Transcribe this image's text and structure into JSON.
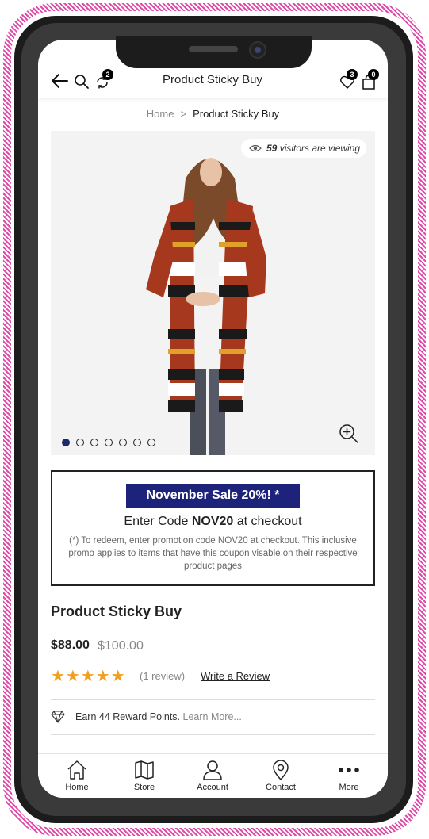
{
  "header": {
    "title": "Product Sticky Buy",
    "compare_count": "2",
    "wishlist_count": "3",
    "cart_count": "0"
  },
  "breadcrumb": {
    "home": "Home",
    "separator": ">",
    "current": "Product Sticky Buy"
  },
  "gallery": {
    "visitors_count": "59",
    "visitors_text": "visitors are viewing",
    "dots_total": 7,
    "active_dot": 1
  },
  "promo": {
    "title": "November Sale 20%! *",
    "code_prefix": "Enter Code ",
    "code": "NOV20",
    "code_suffix": " at checkout",
    "note": "(*) To redeem, enter promotion code NOV20 at checkout. This inclusive promo applies to items that have this coupon visable on their respective product pages"
  },
  "product": {
    "name": "Product Sticky Buy",
    "price": "$88.00",
    "old_price": "$100.00",
    "rating": 5,
    "stars": "★★★★★",
    "review_count": "(1 review)",
    "write_review": "Write a Review",
    "reward_text": "Earn 44 Reward Points.",
    "reward_link": "Learn More..."
  },
  "bottom_nav": [
    {
      "label": "Home",
      "icon": "home-icon"
    },
    {
      "label": "Store",
      "icon": "map-icon"
    },
    {
      "label": "Account",
      "icon": "user-icon"
    },
    {
      "label": "Contact",
      "icon": "location-icon"
    },
    {
      "label": "More",
      "icon": "more-icon"
    }
  ],
  "colors": {
    "accent": "#1d237a",
    "stars": "#f0a020",
    "frame": "#e04aa8"
  }
}
